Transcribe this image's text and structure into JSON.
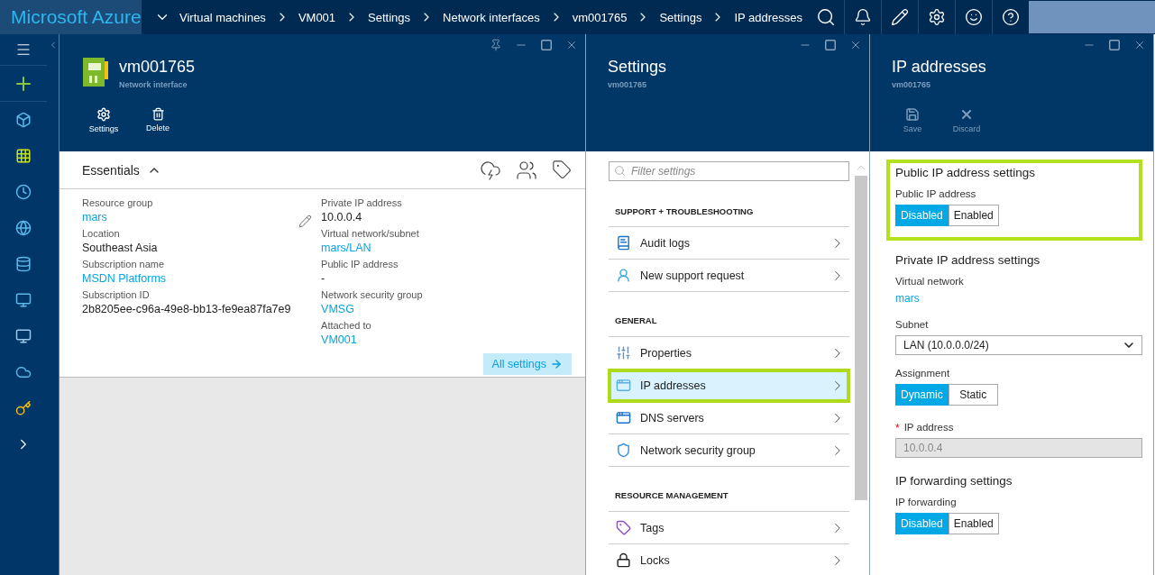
{
  "topbar": {
    "brand": "Microsoft Azure",
    "breadcrumbs": [
      "Virtual machines",
      "VM001",
      "Settings",
      "Network interfaces",
      "vm001765",
      "Settings",
      "IP addresses"
    ]
  },
  "resource_blade": {
    "title": "vm001765",
    "subtitle": "Network interface",
    "commands": [
      {
        "label": "Settings",
        "disabled": false
      },
      {
        "label": "Delete",
        "disabled": false
      }
    ],
    "essentials": {
      "heading": "Essentials",
      "expanded": true,
      "left": [
        {
          "label": "Resource group",
          "value": "mars",
          "link": true
        },
        {
          "label": "Location",
          "value": "Southeast Asia",
          "link": false
        },
        {
          "label": "Subscription name",
          "value": "MSDN Platforms",
          "link": true
        },
        {
          "label": "Subscription ID",
          "value": "2b8205ee-c96a-49e8-bb13-fe9ea87fa7e9",
          "link": false
        }
      ],
      "right": [
        {
          "label": "Private IP address",
          "value": "10.0.0.4",
          "link": false
        },
        {
          "label": "Virtual network/subnet",
          "value": "mars/LAN",
          "link": true
        },
        {
          "label": "Public IP address",
          "value": "-",
          "link": false
        },
        {
          "label": "Network security group",
          "value": "VMSG",
          "link": true
        },
        {
          "label": "Attached to",
          "value": "VM001",
          "link": true
        }
      ],
      "all_settings": "All settings"
    }
  },
  "settings_blade": {
    "title": "Settings",
    "subtitle": "vm001765",
    "filter_placeholder": "Filter settings",
    "sections": [
      {
        "heading": "SUPPORT + TROUBLESHOOTING",
        "items": [
          {
            "label": "Audit logs",
            "selected": false
          },
          {
            "label": "New support request",
            "selected": false
          }
        ]
      },
      {
        "heading": "GENERAL",
        "items": [
          {
            "label": "Properties",
            "selected": false
          },
          {
            "label": "IP addresses",
            "selected": true
          },
          {
            "label": "DNS servers",
            "selected": false
          },
          {
            "label": "Network security group",
            "selected": false
          }
        ]
      },
      {
        "heading": "RESOURCE MANAGEMENT",
        "items": [
          {
            "label": "Tags",
            "selected": false
          },
          {
            "label": "Locks",
            "selected": false
          }
        ]
      }
    ]
  },
  "ip_blade": {
    "title": "IP addresses",
    "subtitle": "vm001765",
    "commands": [
      {
        "label": "Save",
        "disabled": true
      },
      {
        "label": "Discard",
        "disabled": true
      }
    ],
    "public_section": {
      "heading": "Public IP address settings",
      "highlighted": true,
      "field_label": "Public IP address",
      "options": [
        {
          "label": "Disabled",
          "selected": true
        },
        {
          "label": "Enabled",
          "selected": false
        }
      ]
    },
    "private_section": {
      "heading": "Private IP address settings",
      "virtual_network_label": "Virtual network",
      "virtual_network": "mars",
      "subnet_label": "Subnet",
      "subnet_value": "LAN (10.0.0.0/24)",
      "assignment_label": "Assignment",
      "assignment_options": [
        {
          "label": "Dynamic",
          "selected": true
        },
        {
          "label": "Static",
          "selected": false
        }
      ],
      "ip_label": "IP address",
      "required_marker": "*",
      "ip_value": "10.0.0.4",
      "ip_disabled": true
    },
    "forwarding_section": {
      "heading": "IP forwarding settings",
      "field_label": "IP forwarding",
      "options": [
        {
          "label": "Disabled",
          "selected": true
        },
        {
          "label": "Enabled",
          "selected": false
        }
      ]
    }
  }
}
